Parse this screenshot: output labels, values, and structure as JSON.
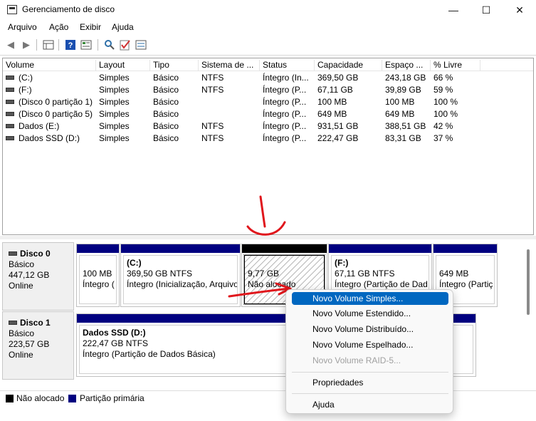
{
  "window": {
    "title": "Gerenciamento de disco",
    "minimize_glyph": "—",
    "maximize_glyph": "☐",
    "close_glyph": "✕"
  },
  "menu": [
    "Arquivo",
    "Ação",
    "Exibir",
    "Ajuda"
  ],
  "toolbar_icons": [
    "back-arrow-icon",
    "forward-arrow-icon",
    "disk-list-icon",
    "help-icon",
    "properties-icon",
    "connect-icon",
    "check-icon",
    "settings-icon"
  ],
  "volume_table": {
    "columns": [
      "Volume",
      "Layout",
      "Tipo",
      "Sistema de ...",
      "Status",
      "Capacidade",
      "Espaço ...",
      "% Livre"
    ],
    "rows": [
      [
        "(C:)",
        "Simples",
        "Básico",
        "NTFS",
        "Íntegro (In...",
        "369,50 GB",
        "243,18 GB",
        "66 %"
      ],
      [
        "(F:)",
        "Simples",
        "Básico",
        "NTFS",
        "Íntegro (P...",
        "67,11 GB",
        "39,89 GB",
        "59 %"
      ],
      [
        "(Disco 0 partição 1)",
        "Simples",
        "Básico",
        "",
        "Íntegro (P...",
        "100 MB",
        "100 MB",
        "100 %"
      ],
      [
        "(Disco 0 partição 5)",
        "Simples",
        "Básico",
        "",
        "Íntegro (P...",
        "649 MB",
        "649 MB",
        "100 %"
      ],
      [
        "Dados (E:)",
        "Simples",
        "Básico",
        "NTFS",
        "Íntegro (P...",
        "931,51 GB",
        "388,51 GB",
        "42 %"
      ],
      [
        "Dados SSD (D:)",
        "Simples",
        "Básico",
        "NTFS",
        "Íntegro (P...",
        "222,47 GB",
        "83,31 GB",
        "37 %"
      ]
    ]
  },
  "disks": [
    {
      "name": "Disco 0",
      "type": "Básico",
      "size": "447,12 GB",
      "status": "Online",
      "partitions": [
        {
          "title": "",
          "size": "100 MB",
          "desc": "Íntegro (",
          "bar": "#000080"
        },
        {
          "title": "(C:)",
          "size": "369,50 GB NTFS",
          "desc": "Íntegro (Inicialização, Arquivo",
          "bar": "#000080"
        },
        {
          "title": "",
          "size": "9,77 GB",
          "desc": "Não alocado",
          "bar": "#000000"
        },
        {
          "title": "(F:)",
          "size": "67,11 GB NTFS",
          "desc": "Íntegro (Partição de Dad",
          "bar": "#000080"
        },
        {
          "title": "",
          "size": "649 MB",
          "desc": "Íntegro (Partiç",
          "bar": "#000080"
        }
      ]
    },
    {
      "name": "Disco 1",
      "type": "Básico",
      "size": "223,57 GB",
      "status": "Online",
      "partitions": [
        {
          "title": "Dados SSD  (D:)",
          "size": "222,47 GB NTFS",
          "desc": "Íntegro (Partição de Dados Básica)",
          "bar": "#000080"
        }
      ]
    }
  ],
  "legend": [
    {
      "label": "Não alocado",
      "color": "#000000"
    },
    {
      "label": "Partição primária",
      "color": "#000080"
    }
  ],
  "context_menu": {
    "items": [
      {
        "label": "Novo Volume Simples...",
        "state": "selected"
      },
      {
        "label": "Novo Volume Estendido...",
        "state": "normal"
      },
      {
        "label": "Novo Volume Distribuído...",
        "state": "normal"
      },
      {
        "label": "Novo Volume Espelhado...",
        "state": "normal"
      },
      {
        "label": "Novo Volume RAID-5...",
        "state": "disabled"
      }
    ],
    "extra": [
      {
        "label": "Propriedades",
        "state": "normal"
      },
      {
        "label": "Ajuda",
        "state": "normal"
      }
    ]
  },
  "annotation_color": "#e0161c"
}
